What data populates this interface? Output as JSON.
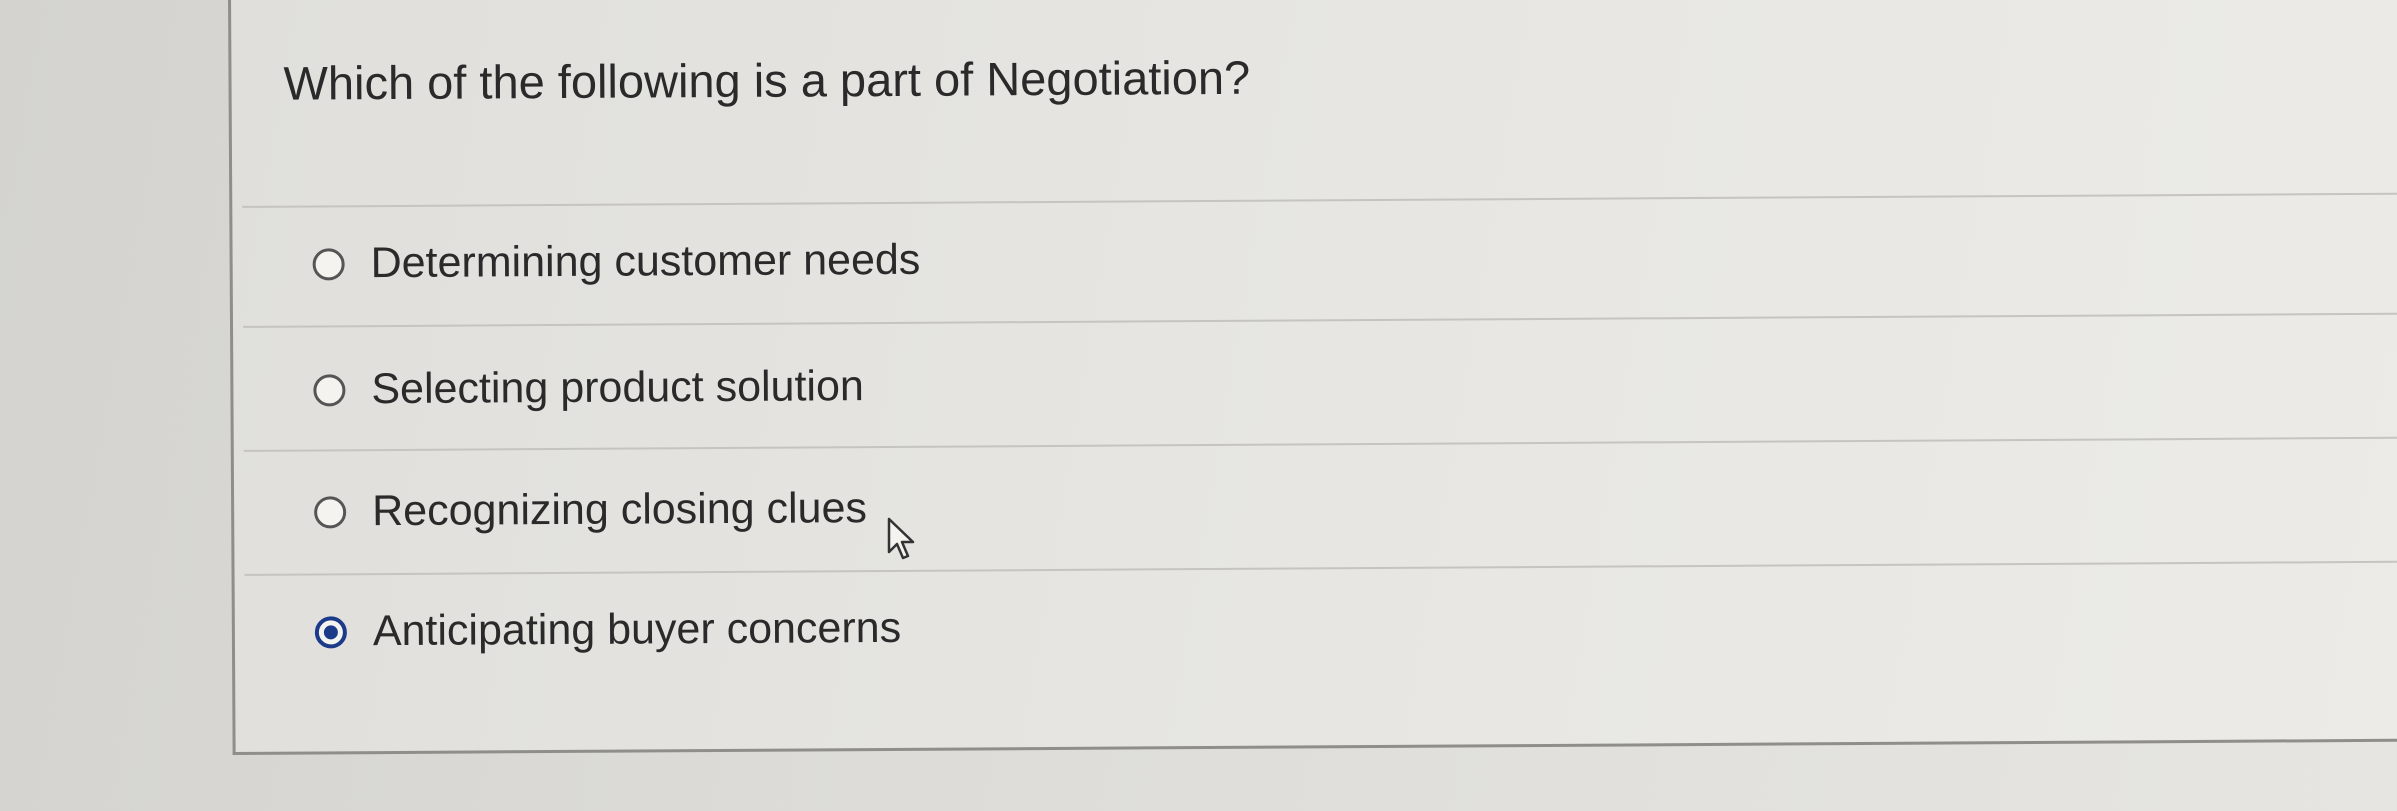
{
  "question": {
    "text": "Which of the following is a part of Negotiation?"
  },
  "options": [
    {
      "label": "Determining customer needs",
      "selected": false
    },
    {
      "label": "Selecting product solution",
      "selected": false
    },
    {
      "label": "Recognizing closing clues",
      "selected": false
    },
    {
      "label": "Anticipating buyer concerns",
      "selected": true
    }
  ],
  "colors": {
    "selected_radio": "#1c3a8a",
    "text": "#2a2a2a"
  }
}
